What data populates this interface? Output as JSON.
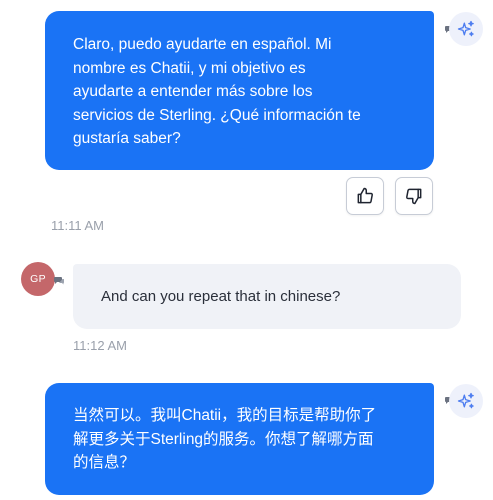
{
  "messages": [
    {
      "sender": "bot",
      "text": "Claro, puedo ayudarte en español. Mi\nnombre es Chatii, y mi objetivo es\nayudarte a entender más sobre los\nservicios de Sterling. ¿Qué información te\ngustaría saber?",
      "icon": "sparkle-icon"
    },
    {
      "sender": "user",
      "avatar_initials": "GP",
      "text": "And can you repeat that in chinese?",
      "timestamp": "11:12 AM"
    },
    {
      "sender": "bot",
      "text": "当然可以。我叫Chatii，我的目标是帮助你了\n解更多关于Sterling的服务。你想了解哪方面\n的信息？",
      "icon": "sparkle-icon"
    }
  ],
  "first_timestamp": "11:11 AM",
  "feedback": {
    "thumbs_up_icon": "thumbs-up-icon",
    "thumbs_down_icon": "thumbs-down-icon"
  },
  "colors": {
    "bot_bubble": "#1a73f5",
    "user_bubble": "#f0f2f7",
    "user_avatar": "#c4676a",
    "bot_avatar_bg": "#eef1fb",
    "timestamp": "#9aa0ab"
  }
}
